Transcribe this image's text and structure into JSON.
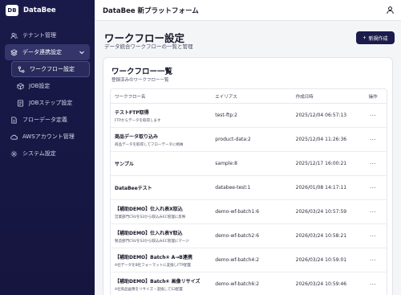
{
  "brand": {
    "logo": "DB",
    "name": "DataBee"
  },
  "header": {
    "title": "DataBee 新プラットフォーム",
    "user_icon": "user-icon"
  },
  "sidebar": {
    "items": [
      {
        "label": "テナント管理",
        "icon": "users-icon",
        "level": 0,
        "state": "normal"
      },
      {
        "label": "データ連携設定",
        "icon": "layers-icon",
        "level": 0,
        "state": "expanded"
      },
      {
        "label": "ワークフロー設定",
        "icon": "workflow-icon",
        "level": 1,
        "state": "active"
      },
      {
        "label": "JOB設定",
        "icon": "cube-icon",
        "level": 1,
        "state": "normal"
      },
      {
        "label": "JOBステップ設定",
        "icon": "list-icon",
        "level": 1,
        "state": "normal"
      },
      {
        "label": "フローデータ定義",
        "icon": "file-icon",
        "level": 0,
        "state": "normal"
      },
      {
        "label": "AWSアカウント管理",
        "icon": "cloud-icon",
        "level": 0,
        "state": "normal"
      },
      {
        "label": "システム設定",
        "icon": "gear-icon",
        "level": 0,
        "state": "normal"
      }
    ]
  },
  "page": {
    "title": "ワークフロー設定",
    "subtitle": "データ統合ワークフローの一覧と管理",
    "new_button": "新規作成"
  },
  "card": {
    "title": "ワークフロー一覧",
    "subtitle": "登録済みのワークフロー一覧"
  },
  "table": {
    "columns": [
      "ワークフロー名",
      "エイリアス",
      "作成日時",
      "操作"
    ],
    "rows": [
      {
        "name": "テストFTP取得",
        "desc": "FTPからデータを取得します",
        "alias": "test-ftp:2",
        "date": "2025/12/04 06:57:13",
        "action": "···"
      },
      {
        "name": "商品データ取り込み",
        "desc": "商品データを取得してフローデータに格納",
        "alias": "product-data:2",
        "date": "2025/12/04 11:26:36",
        "action": "···"
      },
      {
        "name": "サンプル",
        "desc": "",
        "alias": "sample:8",
        "date": "2025/12/17 16:00:21",
        "action": "···"
      },
      {
        "name": "DataBeeテスト",
        "desc": "",
        "alias": "databee-test:1",
        "date": "2026/01/08 14:17:11",
        "action": "···"
      },
      {
        "name": "【補助DEMO】仕入れ表X取込",
        "desc": "営業部門CSVをS3から取込みEC管理に反映",
        "alias": "demo-wf-batch1:6",
        "date": "2026/03/24 10:57:59",
        "action": "···"
      },
      {
        "name": "【補助DEMO】仕入れ表Y取込",
        "desc": "製造部門CSVをS3から取込みEC管理にマージ",
        "alias": "demo-wf-batch2:6",
        "date": "2026/03/24 10:58:21",
        "action": "···"
      },
      {
        "name": "【補助DEMO】Batch④ A→B連携",
        "desc": "A社データをB社フォーマットに変換しFTP配置",
        "alias": "demo-wf-batch4:2",
        "date": "2026/03/24 10:59:01",
        "action": "···"
      },
      {
        "name": "【補助DEMO】Batch⑥ 画像リサイズ",
        "desc": "A社商品画像をリサイズ・変換してS3配置",
        "alias": "demo-wf-batch6:2",
        "date": "2026/03/24 10:59:46",
        "action": "···"
      }
    ]
  }
}
